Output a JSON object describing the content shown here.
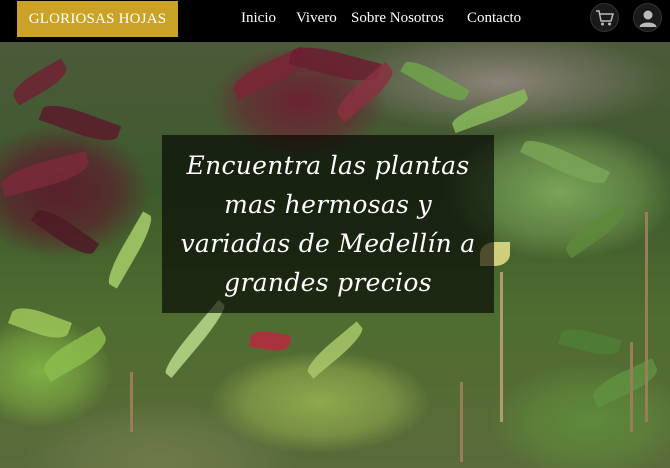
{
  "brand": {
    "label": "GLORIOSAS HOJAS",
    "color": "#c9a227"
  },
  "nav": {
    "items": [
      {
        "label": "Inicio"
      },
      {
        "label": "Vivero"
      },
      {
        "label": "Sobre Nosotros"
      },
      {
        "label": "Contacto"
      }
    ]
  },
  "icons": {
    "cart": "cart-icon",
    "user": "user-icon"
  },
  "hero": {
    "headline": "Encuentra las plantas mas hermosas y variadas de Medellín a grandes precios"
  }
}
